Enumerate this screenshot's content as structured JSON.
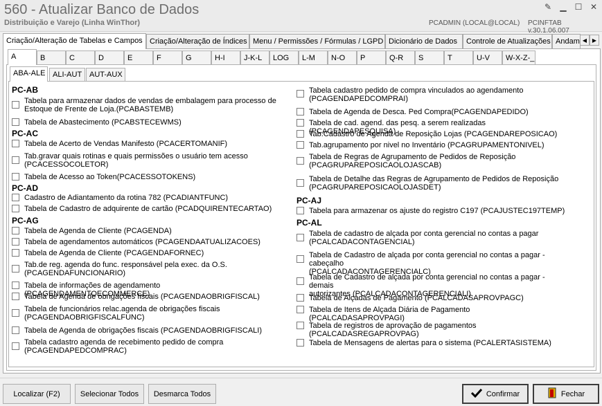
{
  "window": {
    "title": "560 - Atualizar Banco de Dados",
    "subtitle": "Distribuição e Varejo (Linha WinThor)",
    "user_info": "PCADMIN (LOCAL@LOCAL)",
    "version": "PCINFTAB v.30.1.06.007"
  },
  "main_tabs": [
    "Criação/Alteração de Tabelas e Campos",
    "Criação/Alteração de Índices",
    "Menu / Permissões / Fórmulas / LGPD",
    "Dicionário de Dados",
    "Controle de Atualizações",
    "Andame"
  ],
  "letter_tabs": [
    "A",
    "B",
    "C",
    "D",
    "E",
    "F",
    "G",
    "H-I",
    "J-K-L",
    "LOG",
    "L-M",
    "N-O",
    "P",
    "Q-R",
    "S",
    "T",
    "U-V",
    "W-X-Z-_"
  ],
  "sub_tabs": [
    "ABA-ALE",
    "ALI-AUT",
    "AUT-AUX"
  ],
  "left_column": {
    "groups": [
      {
        "title": "PC-AB",
        "items": [
          {
            "line1": "Tabela para armazenar dados de vendas de embalagem para processo de",
            "line2": "Estoque de Frente de Loja.(PCABASTEMB)"
          },
          {
            "line1": "Tabela de Abastecimento (PCABSTECEWMS)",
            "line2": ""
          }
        ]
      },
      {
        "title": "PC-AC",
        "items": [
          {
            "line1": "Tabela de Acerto de Vendas Manifesto (PCACERTOMANIF)",
            "line2": ""
          },
          {
            "line1": "Tab.gravar quais rotinas e quais permissões o usuário tem acesso",
            "line2": "(PCACESSOCOLETOR)"
          },
          {
            "line1": "Tabela de Acesso ao Token(PCACESSOTOKENS)",
            "line2": ""
          }
        ]
      },
      {
        "title": "PC-AD",
        "items": [
          {
            "line1": "Cadastro de Adiantamento da rotina 782 (PCADIANTFUNC)",
            "line2": ""
          },
          {
            "line1": "Tabela de Cadastro de adquirente de cartão (PCADQUIRENTECARTAO)",
            "line2": ""
          }
        ]
      },
      {
        "title": "PC-AG",
        "items": [
          {
            "line1": "Tabela  de Agenda de Cliente (PCAGENDA)",
            "line2": ""
          },
          {
            "line1": "Tabela de agendamentos automáticos (PCAGENDAATUALIZACOES)",
            "line2": ""
          },
          {
            "line1": "Tabela  de Agenda de Cliente (PCAGENDAFORNEC)",
            "line2": ""
          },
          {
            "line1": "Tab.de reg. agenda do func. responsável pela exec. da O.S.",
            "line2": "(PCAGENDAFUNCIONARIO)"
          },
          {
            "line1": "Tabela de informações de agendamento (PCAGENDAMENTOECOMMERCE)",
            "line2": ""
          },
          {
            "line1": "Tabela de Agenda de obrigações fiscais (PCAGENDAOBRIGFISCAL)",
            "line2": ""
          },
          {
            "line1": "Tabela de funcionários relac.agenda de obrigações fiscais",
            "line2": "(PCAGENDAOBRIGFISCALFUNC)"
          },
          {
            "line1": "Tabela de Agenda de obrigações fiscais (PCAGENDAOBRIGFISCALI)",
            "line2": ""
          },
          {
            "line1": "Tabela cadastro agenda de recebimento pedido de compra",
            "line2": "(PCAGENDAPEDCOMPRAC)"
          }
        ]
      }
    ]
  },
  "right_column": {
    "groups": [
      {
        "title": "",
        "items": [
          {
            "line1": "Tabela cadastro pedido de compra vinculados ao agendamento",
            "line2": "(PCAGENDAPEDCOMPRAI)"
          },
          {
            "line1": "Tabela  de Agenda de Desca. Ped Compra(PCAGENDAPEDIDO)",
            "line2": ""
          },
          {
            "line1": "Tabela de cad. agend. das pesq. a serem realizadas (PCAGENDAPESQUISA)",
            "line2": ""
          },
          {
            "line1": "Tab.Cadastro de Agenda de Reposição Lojas (PCAGENDAREPOSICAO)",
            "line2": ""
          },
          {
            "line1": "Tab.agrupamento por nivel no Inventário (PCAGRUPAMENTONIVEL)",
            "line2": ""
          },
          {
            "line1": "Tabela de Regras de Agrupamento de Pedidos de Reposição",
            "line2": "(PCAGRUPAREPOSICAOLOJASCAB)"
          },
          {
            "line1": "Tabela de Detalhe das Regras de Agrupamento de Pedidos de Reposição",
            "line2": "(PCAGRUPAREPOSICAOLOJASDET)"
          }
        ]
      },
      {
        "title": "PC-AJ",
        "items": [
          {
            "line1": "Tabela para armazenar os ajuste do registro C197 (PCAJUSTEC197TEMP)",
            "line2": ""
          }
        ]
      },
      {
        "title": "PC-AL",
        "items": [
          {
            "line1": "Tabela de cadastro de alçada por conta gerencial no contas a pagar",
            "line2": "(PCALCADACONTAGENCIAL)"
          },
          {
            "line1": "Tabela de Cadastro de alçada por conta gerencial no contas a pagar - cabeçalho",
            "line2": "(PCALCADACONTAGERENCIALC)"
          },
          {
            "line1": "Tabela de Cadastro de alçada por conta gerencial no contas a pagar - demais",
            "line2": "autorizantes (PCALCADACONTAGERENCIALI)"
          },
          {
            "line1": "Tabela de Alçadas de Pagamento (PCALCADASAPROVPAGC)",
            "line2": ""
          },
          {
            "line1": "Tabela de Itens de Alçada Diária de Pagamento (PCALCADASAPROVPAGI)",
            "line2": ""
          },
          {
            "line1": "Tabela de registros de aprovação de pagamentos (PCALCADASREGAPROVPAG)",
            "line2": ""
          },
          {
            "line1": "Tabela de Mensagens de alertas para o sistema (PCALERTASISTEMA)",
            "line2": ""
          }
        ]
      }
    ]
  },
  "buttons": {
    "localizar": "Localizar (F2)",
    "selecionar_todos": "Selecionar Todos",
    "desmarca_todos": "Desmarca Todos",
    "confirmar": "Confirmar",
    "fechar": "Fechar"
  }
}
